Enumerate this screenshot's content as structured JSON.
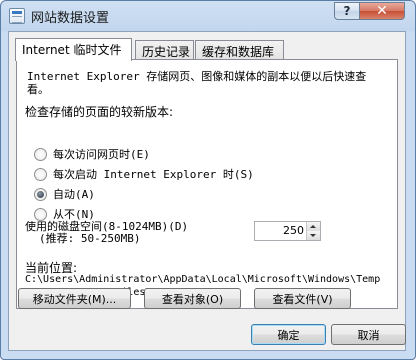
{
  "window": {
    "title": "网站数据设置",
    "help_label": "?",
    "close_label": "✕"
  },
  "tabs": [
    {
      "label": "Internet 临时文件",
      "active": true
    },
    {
      "label": "历史记录",
      "active": false
    },
    {
      "label": "缓存和数据库",
      "active": false
    }
  ],
  "temp_files": {
    "description": "Internet Explorer 存储网页、图像和媒体的副本以便以后快速查看。",
    "check_label": "检查存储的页面的较新版本:",
    "options": [
      {
        "label": "每次访问网页时(E)",
        "checked": false
      },
      {
        "label": "每次启动 Internet Explorer 时(S)",
        "checked": false
      },
      {
        "label": "自动(A)",
        "checked": true
      },
      {
        "label": "从不(N)",
        "checked": false
      }
    ],
    "disk_label": "使用的磁盘空间(8-1024MB)(D)",
    "disk_hint": "(推荐: 50-250MB)",
    "disk_value": "250",
    "location_label": "当前位置:",
    "location_path": "C:\\Users\\Administrator\\AppData\\Local\\Microsoft\\Windows\\Temporary Internet Files\\",
    "buttons": {
      "move": "移动文件夹(M)...",
      "view_objects": "查看对象(O)",
      "view_files": "查看文件(V)"
    }
  },
  "footer": {
    "ok": "确定",
    "cancel": "取消"
  }
}
